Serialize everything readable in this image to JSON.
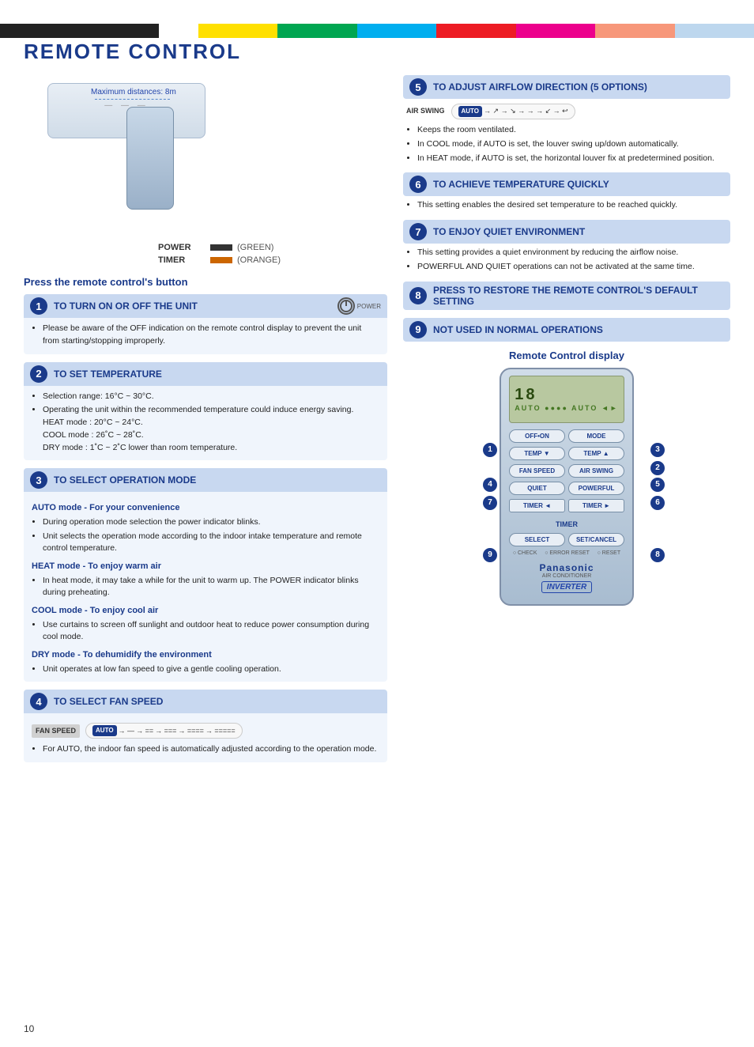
{
  "page": {
    "title": "REMOTE CONTROL",
    "page_number": "10"
  },
  "header": {
    "color_bars": [
      "black",
      "white",
      "yellow",
      "green",
      "cyan",
      "red",
      "magenta",
      "pink",
      "lightblue"
    ]
  },
  "ac_unit": {
    "distance_label": "Maximum distances: 8m"
  },
  "indicators": [
    {
      "label": "POWER",
      "color": "(GREEN)"
    },
    {
      "label": "TIMER",
      "color": "(ORANGE)"
    }
  ],
  "remote_button_section_title": "Press the remote control's button",
  "sections_left": [
    {
      "number": "1",
      "title": "TO TURN ON OR OFF THE UNIT",
      "body_items": [
        "Please be aware of the OFF indication on the remote control display to prevent the unit from starting/stopping improperly."
      ],
      "has_power_icon": true
    },
    {
      "number": "2",
      "title": "TO SET TEMPERATURE",
      "body_items": [
        "Selection range: 16°C ~ 30°C.",
        "Operating the unit within the recommended temperature could induce energy saving. HEAT mode : 20°C ~ 24°C. COOL mode : 26˚C ~ 28˚C. DRY mode : 1˚C ~ 2˚C lower than room temperature."
      ]
    },
    {
      "number": "3",
      "title": "TO SELECT OPERATION MODE",
      "sub_sections": [
        {
          "title": "AUTO mode - For your convenience",
          "items": [
            "During operation mode selection the power indicator blinks.",
            "Unit selects the operation mode according to the indoor intake temperature and remote control temperature."
          ]
        },
        {
          "title": "HEAT mode - To enjoy warm air",
          "items": [
            "In heat mode, it may take a while for the unit to warm up. The POWER indicator blinks during preheating."
          ]
        },
        {
          "title": "COOL mode - To enjoy cool air",
          "items": [
            "Use curtains to screen off sunlight and outdoor heat to reduce power consumption during cool mode."
          ]
        },
        {
          "title": "DRY mode - To dehumidify the environment",
          "items": [
            "Unit operates at low fan speed to give a gentle cooling operation."
          ]
        }
      ]
    },
    {
      "number": "4",
      "title": "TO SELECT FAN SPEED",
      "fan_speed_label": "FAN SPEED",
      "fan_speed_seq": "AUTO → — → == → === → ==== → =====",
      "body_items": [
        "For AUTO, the indoor fan speed is automatically adjusted according to the operation mode."
      ]
    }
  ],
  "sections_right": [
    {
      "number": "5",
      "title": "TO ADJUST AIRFLOW DIRECTION (5 OPTIONS)",
      "air_swing_label": "AIR SWING",
      "air_swing_seq": "AUTO → ↖ → ↗ → → → ↘ → ↙ → ↩",
      "body_items": [
        "Keeps the room ventilated.",
        "In COOL mode, if AUTO is set, the louver swing up/down automatically.",
        "In HEAT mode, if AUTO is set, the horizontal louver fix at predetermined position."
      ]
    },
    {
      "number": "6",
      "title": "TO ACHIEVE TEMPERATURE QUICKLY",
      "body_items": [
        "This setting enables the desired set temperature to be reached quickly."
      ]
    },
    {
      "number": "7",
      "title": "TO ENJOY QUIET ENVIRONMENT",
      "body_items": [
        "This setting provides a quiet environment by reducing the airflow noise.",
        "POWERFUL AND QUIET operations can not be activated at the same time."
      ]
    },
    {
      "number": "8",
      "title": "PRESS TO RESTORE THE REMOTE CONTROL'S DEFAULT SETTING",
      "body_items": []
    },
    {
      "number": "9",
      "title": "NOT USED IN NORMAL OPERATIONS",
      "body_items": []
    }
  ],
  "remote_display": {
    "title": "Remote Control display",
    "screen_temp": "18",
    "buttons": [
      {
        "label": "OFF•ON",
        "row": 1,
        "col": 1
      },
      {
        "label": "MODE",
        "row": 1,
        "col": 2
      },
      {
        "label": "TEMP ▼",
        "row": 2,
        "col": 1
      },
      {
        "label": "TEMP ▲",
        "row": 2,
        "col": 2
      },
      {
        "label": "FAN SPEED",
        "row": 3,
        "col": 1
      },
      {
        "label": "AIR SWING",
        "row": 3,
        "col": 2
      },
      {
        "label": "QUIET",
        "row": 4,
        "col": 1
      },
      {
        "label": "POWERFUL",
        "row": 4,
        "col": 2
      },
      {
        "label": "TIMER ◄",
        "row": 5,
        "col": 1
      },
      {
        "label": "TIMER ►",
        "row": 5,
        "col": 2
      },
      {
        "label": "TIMER",
        "row": 6,
        "col": 0
      },
      {
        "label": "SELECT",
        "row": 7,
        "col": 1
      },
      {
        "label": "SET/CANCEL",
        "row": 7,
        "col": 2
      }
    ],
    "brand": "Panasonic",
    "brand_sub": "AIR CONDITIONER",
    "brand_inverter": "INVERTER",
    "callouts": [
      {
        "number": "1",
        "side": "left",
        "row": 1
      },
      {
        "number": "4",
        "side": "left",
        "row": 3
      },
      {
        "number": "7",
        "side": "left",
        "row": 4
      },
      {
        "number": "9",
        "side": "left",
        "row": 7
      },
      {
        "number": "3",
        "side": "right",
        "row": 1
      },
      {
        "number": "2",
        "side": "right",
        "row": 2
      },
      {
        "number": "5",
        "side": "right",
        "row": 3
      },
      {
        "number": "6",
        "side": "right",
        "row": 4
      },
      {
        "number": "8",
        "side": "right",
        "row": 7
      }
    ]
  }
}
